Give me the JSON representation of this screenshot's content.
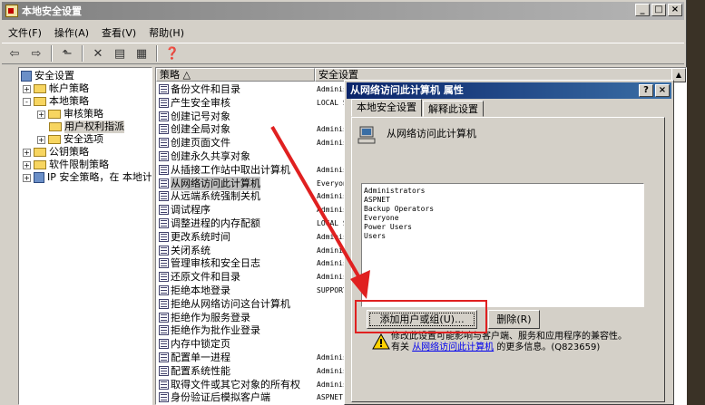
{
  "window": {
    "title": "本地安全设置",
    "buttons": [
      "_",
      "□",
      "×"
    ]
  },
  "menu": [
    "文件(F)",
    "操作(A)",
    "查看(V)",
    "帮助(H)"
  ],
  "toolbar": [
    "back",
    "forward",
    "up",
    "delete",
    "properties",
    "export",
    "help"
  ],
  "tree": [
    {
      "label": "安全设置",
      "depth": 0,
      "expander": ""
    },
    {
      "label": "帐户策略",
      "depth": 1,
      "expander": "+"
    },
    {
      "label": "本地策略",
      "depth": 1,
      "expander": "-"
    },
    {
      "label": "审核策略",
      "depth": 2,
      "expander": "+"
    },
    {
      "label": "用户权利指派",
      "depth": 2,
      "expander": "",
      "selected": true
    },
    {
      "label": "安全选项",
      "depth": 2,
      "expander": "+"
    },
    {
      "label": "公钥策略",
      "depth": 1,
      "expander": "+"
    },
    {
      "label": "软件限制策略",
      "depth": 1,
      "expander": "+"
    },
    {
      "label": "IP 安全策略，在 本地计",
      "depth": 1,
      "expander": "+"
    }
  ],
  "list": {
    "columns": [
      "策略 △",
      "安全设置"
    ],
    "rows": [
      {
        "name": "备份文件和目录",
        "setting": "Administrators"
      },
      {
        "name": "产生安全审核",
        "setting": "LOCAL SERVICE"
      },
      {
        "name": "创建记号对象",
        "setting": ""
      },
      {
        "name": "创建全局对象",
        "setting": "Administrators"
      },
      {
        "name": "创建页面文件",
        "setting": "Administrators"
      },
      {
        "name": "创建永久共享对象",
        "setting": ""
      },
      {
        "name": "从插接工作站中取出计算机",
        "setting": "Administrators"
      },
      {
        "name": "从网络访问此计算机",
        "setting": "Everyone",
        "selected": true
      },
      {
        "name": "从远端系统强制关机",
        "setting": "Administrators"
      },
      {
        "name": "调试程序",
        "setting": "Administrators"
      },
      {
        "name": "调整进程的内存配额",
        "setting": "LOCAL SERVICE"
      },
      {
        "name": "更改系统时间",
        "setting": "Administrators"
      },
      {
        "name": "关闭系统",
        "setting": "Administrators"
      },
      {
        "name": "管理审核和安全日志",
        "setting": "Administrators"
      },
      {
        "name": "还原文件和目录",
        "setting": "Administrators"
      },
      {
        "name": "拒绝本地登录",
        "setting": "SUPPORT"
      },
      {
        "name": "拒绝从网络访问这台计算机",
        "setting": ""
      },
      {
        "name": "拒绝作为服务登录",
        "setting": ""
      },
      {
        "name": "拒绝作为批作业登录",
        "setting": ""
      },
      {
        "name": "内存中锁定页",
        "setting": ""
      },
      {
        "name": "配置单一进程",
        "setting": "Administrators"
      },
      {
        "name": "配置系统性能",
        "setting": "Administrators"
      },
      {
        "name": "取得文件或其它对象的所有权",
        "setting": "Administrators"
      },
      {
        "name": "身份验证后模拟客户端",
        "setting": "ASPNET"
      }
    ]
  },
  "dialog": {
    "title": "从网络访问此计算机 属性",
    "title_buttons": [
      "?",
      "×"
    ],
    "tabs": [
      "本地安全设置",
      "解释此设置"
    ],
    "policy_name": "从网络访问此计算机",
    "members": [
      "Administrators",
      "ASPNET",
      "Backup Operators",
      "Everyone",
      "Power Users",
      "Users"
    ],
    "add_button": "添加用户或组(U)...",
    "remove_button": "删除(R)",
    "warning_line1": "修改此设置可能影响与客户端、服务和应用程序的兼容性。",
    "warning_prefix": "有关",
    "warning_link": "从网络访问此计算机",
    "warning_suffix": "的更多信息。(Q823659)"
  },
  "colors": {
    "highlight": "#e02020",
    "dialog_title": "#0a246a",
    "link": "#0000ee"
  }
}
